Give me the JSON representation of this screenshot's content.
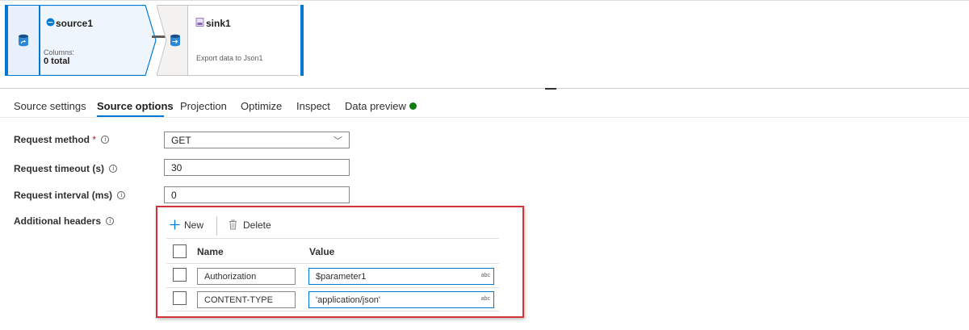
{
  "canvas": {
    "source_node": {
      "title": "source1",
      "columns_label": "Columns:",
      "columns_total": "0 total",
      "icon": "source-database-icon",
      "title_icon": "source-type-icon"
    },
    "sink_node": {
      "title": "sink1",
      "description": "Export data to Json1",
      "icon": "sink-database-icon",
      "title_icon": "sink-type-icon"
    }
  },
  "tabs": [
    {
      "label": "Source settings",
      "active": false
    },
    {
      "label": "Source options",
      "active": true
    },
    {
      "label": "Projection",
      "active": false
    },
    {
      "label": "Optimize",
      "active": false
    },
    {
      "label": "Inspect",
      "active": false
    },
    {
      "label": "Data preview",
      "active": false,
      "status_color": "#107c10"
    }
  ],
  "form": {
    "request_method": {
      "label": "Request method",
      "required_mark": "*",
      "info": "ⓘ",
      "value": "GET"
    },
    "request_timeout": {
      "label": "Request timeout (s)",
      "info": "ⓘ",
      "value": "30"
    },
    "request_interval": {
      "label": "Request interval (ms)",
      "info": "ⓘ",
      "value": "0"
    },
    "additional_headers": {
      "label": "Additional headers",
      "info": "ⓘ",
      "toolbar": {
        "new_label": "New",
        "delete_label": "Delete"
      },
      "columns": {
        "name": "Name",
        "value": "Value"
      },
      "rows": [
        {
          "name": "Authorization",
          "value": "$parameter1",
          "type_badge": "abc"
        },
        {
          "name": "CONTENT-TYPE",
          "value": "'application/json'",
          "type_badge": "abc"
        }
      ]
    }
  },
  "colors": {
    "accent": "#0078d4",
    "highlight_border": "#d13438",
    "status_ok": "#107c10"
  }
}
